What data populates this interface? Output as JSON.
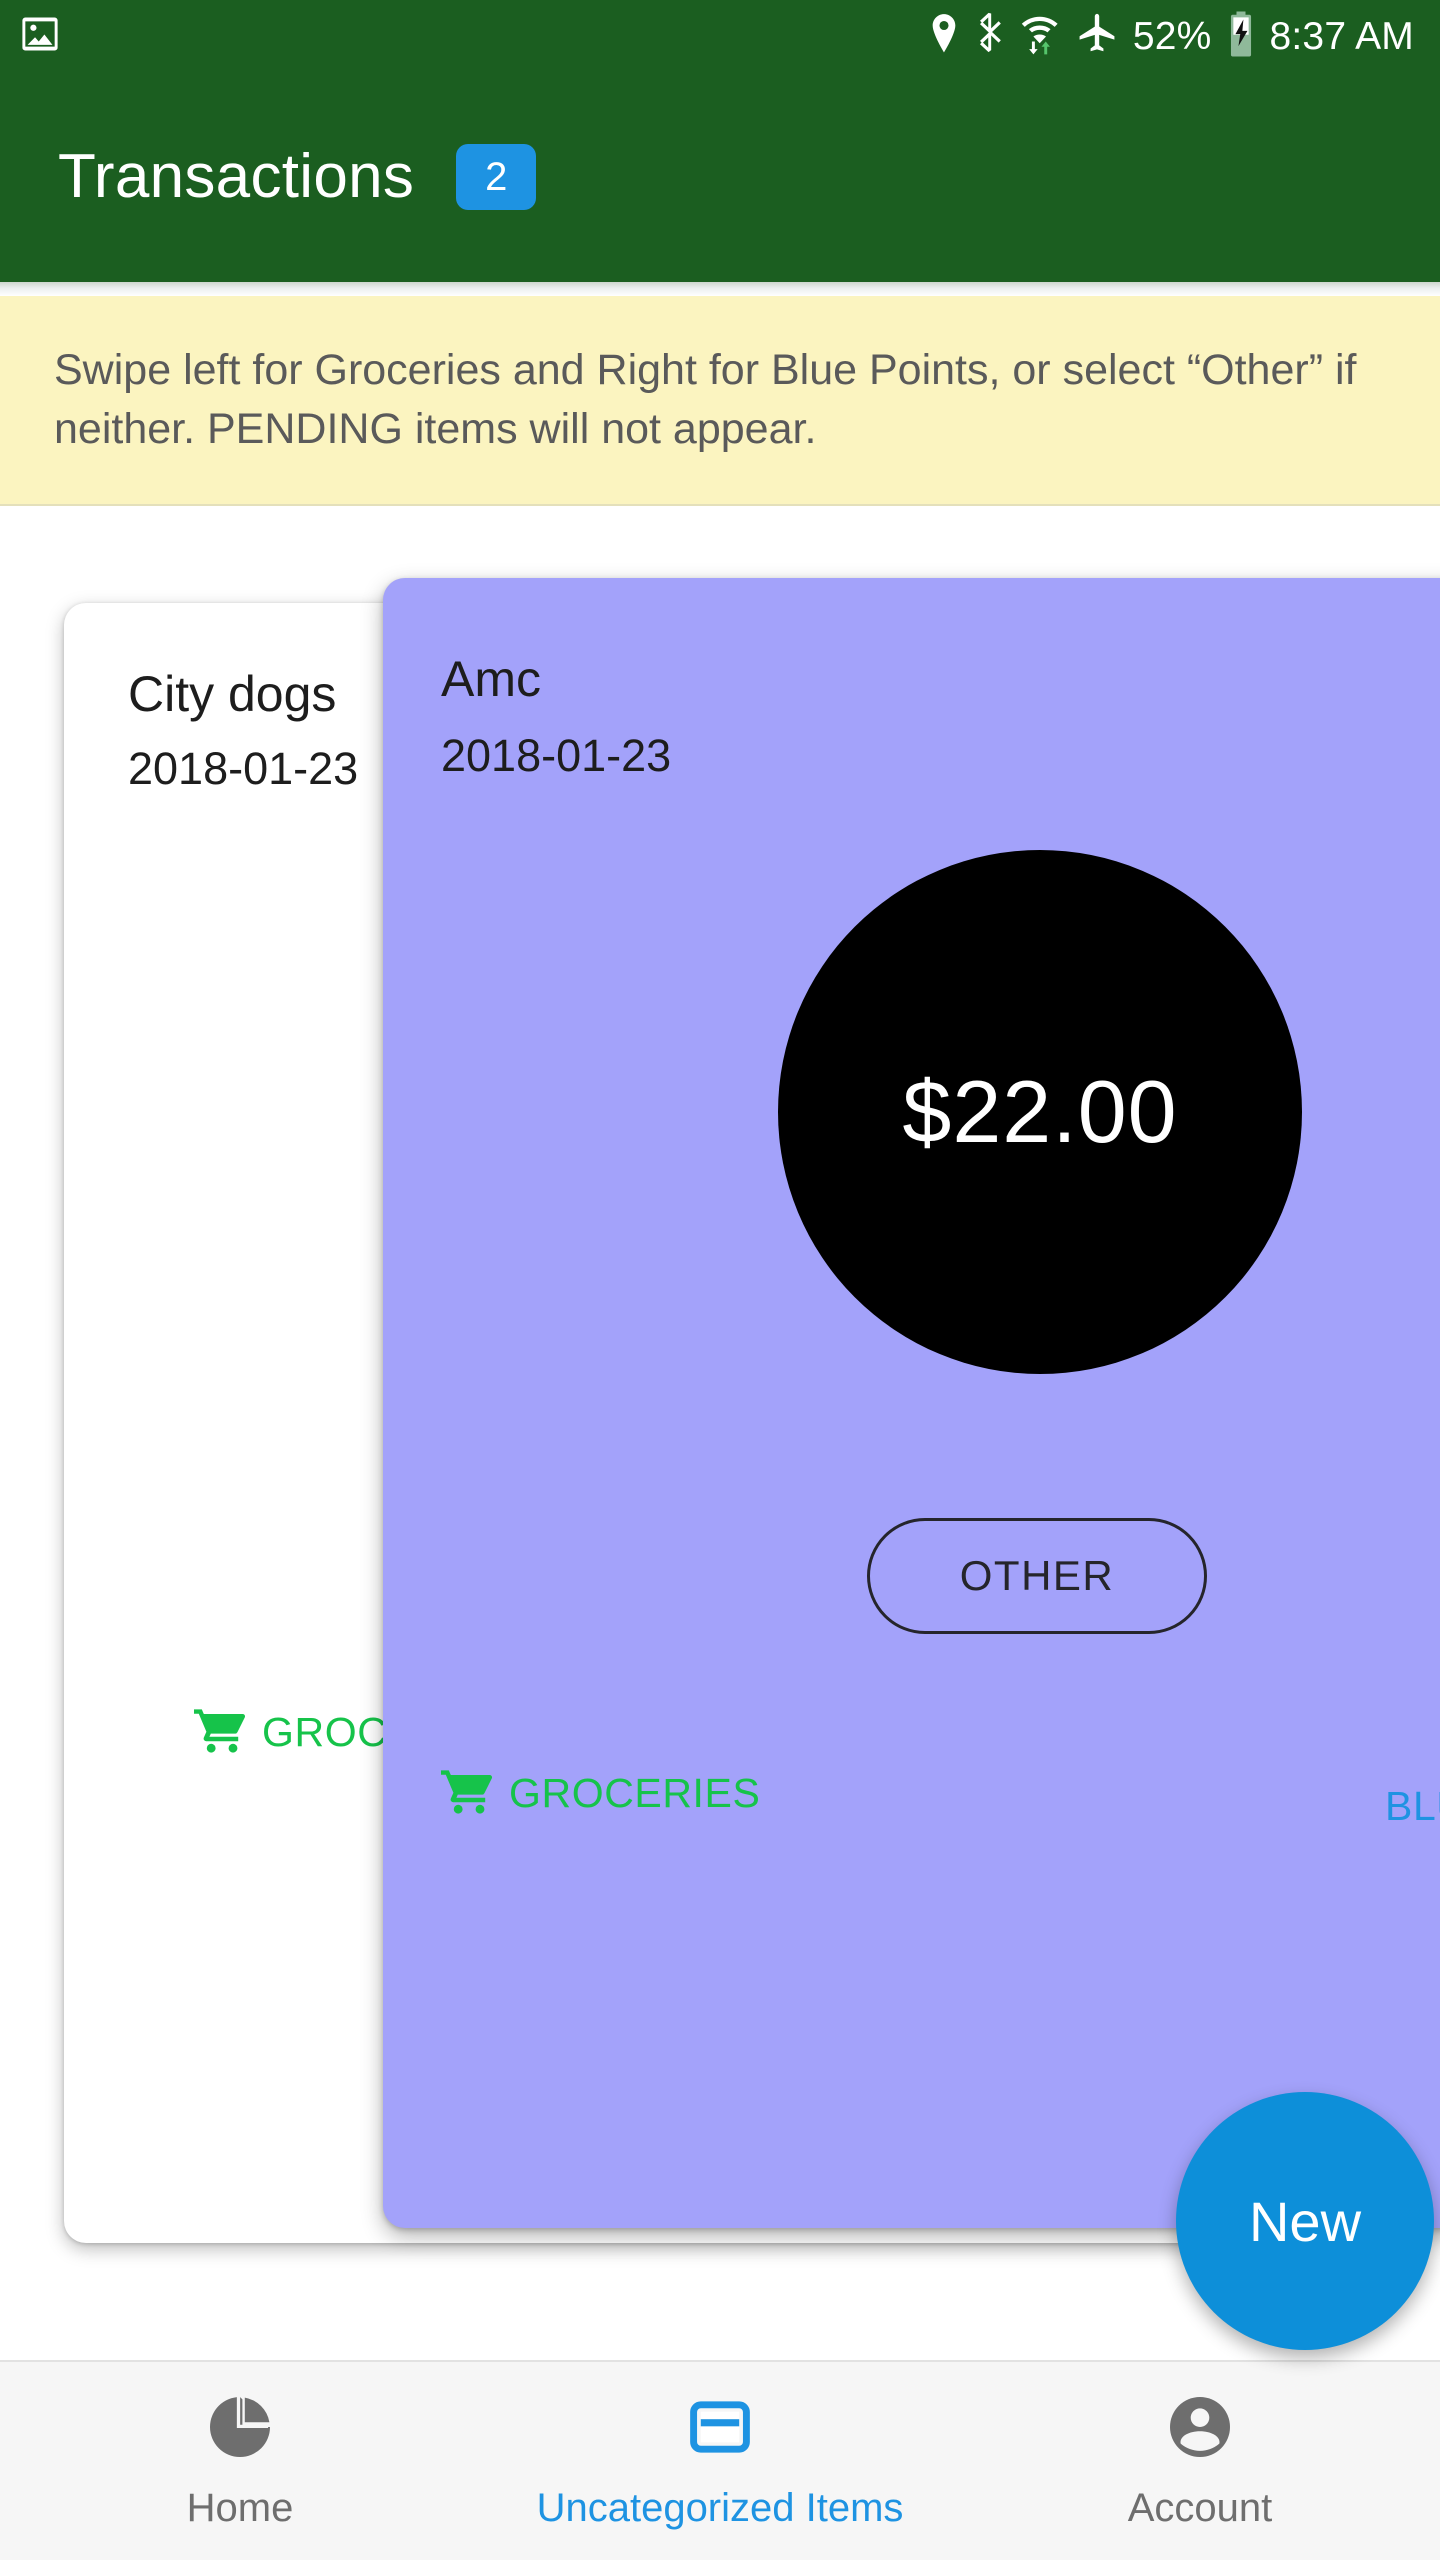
{
  "statusbar": {
    "notification_icon": "image-icon",
    "icons": [
      "location-pin-icon",
      "bluetooth-icon",
      "wifi-icon",
      "airplane-mode-icon"
    ],
    "battery_percent": "52%",
    "battery_icon": "battery-charging-icon",
    "time": "8:37 AM",
    "background_color": "#1b5e20"
  },
  "appbar": {
    "title": "Transactions",
    "badge_count": "2",
    "badge_color": "#1e93e2",
    "background_color": "#1b5e20"
  },
  "banner": {
    "text": "Swipe left for Groceries and Right for Blue Points, or select “Other” if neither. PENDING items will not appear.",
    "background_color": "#fbf4c0",
    "text_color": "#5a5a5a"
  },
  "cards": {
    "back_card": {
      "merchant": "City dogs",
      "date": "2018-01-23",
      "background_color": "#ffffff",
      "swipe_left": {
        "icon": "shopping-cart-icon",
        "label": "GROCERIES",
        "color": "#16c34a"
      }
    },
    "front_card": {
      "merchant": "Amc",
      "date": "2018-01-23",
      "amount": "$22.00",
      "amount_circle_color": "#000000",
      "amount_text_color": "#ffffff",
      "background_color": "#a3a2fa",
      "other_button_label": "OTHER",
      "swipe_left": {
        "icon": "shopping-cart-icon",
        "label": "GROCERIES",
        "color": "#16c34a"
      },
      "swipe_right": {
        "label": "BLUE POINTS",
        "color": "#1e93e2"
      }
    }
  },
  "fab": {
    "label": "New",
    "color": "#0d8fd9"
  },
  "bottomnav": {
    "active_color": "#1e93e2",
    "inactive_color": "#6e6e6e",
    "items": [
      {
        "label": "Home",
        "icon": "pie-chart-icon",
        "active": false
      },
      {
        "label": "Uncategorized Items",
        "icon": "credit-card-icon",
        "active": true
      },
      {
        "label": "Account",
        "icon": "person-circle-icon",
        "active": false
      }
    ]
  }
}
